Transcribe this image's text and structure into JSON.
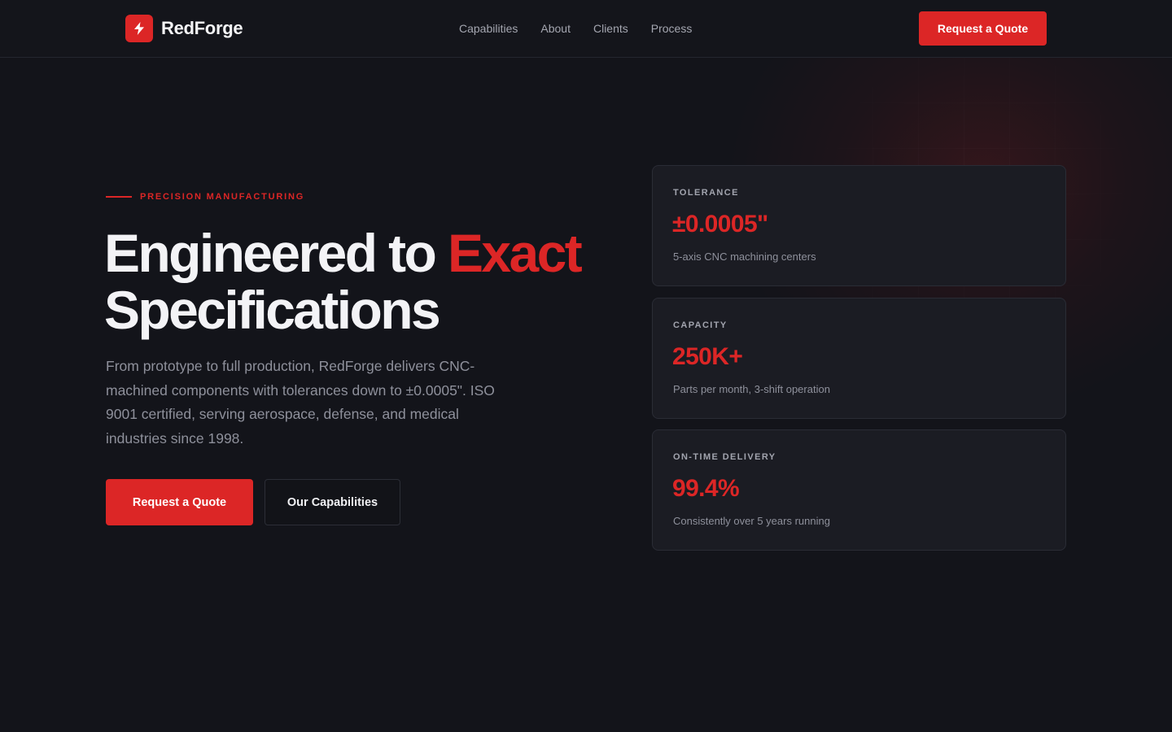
{
  "brand": {
    "name": "RedForge",
    "logo_icon": "lightning-bolt-icon",
    "accent_color": "#dc2626"
  },
  "nav": {
    "links": [
      "Capabilities",
      "About",
      "Clients",
      "Process"
    ],
    "cta_label": "Request a Quote"
  },
  "hero": {
    "eyebrow": "PRECISION MANUFACTURING",
    "headline_part1": "Engineered to ",
    "headline_accent": "Exact",
    "headline_part2": "Specifications",
    "lede": "From prototype to full production, RedForge delivers CNC-machined components with tolerances down to ±0.0005\". ISO 9001 certified, serving aerospace, defense, and medical industries since 1998.",
    "primary_cta": "Request a Quote",
    "secondary_cta": "Our Capabilities"
  },
  "stats": [
    {
      "label": "TOLERANCE",
      "value": "±0.0005\"",
      "desc": "5-axis CNC machining centers"
    },
    {
      "label": "CAPACITY",
      "value": "250K+",
      "desc": "Parts per month, 3-shift operation"
    },
    {
      "label": "ON-TIME DELIVERY",
      "value": "99.4%",
      "desc": "Consistently over 5 years running"
    }
  ]
}
